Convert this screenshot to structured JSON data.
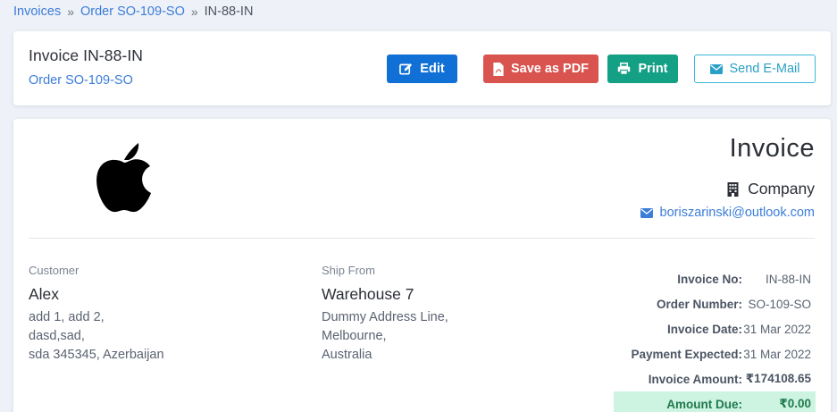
{
  "breadcrumb": {
    "items": [
      "Invoices",
      "Order SO-109-SO",
      "IN-88-IN"
    ],
    "separator": "»"
  },
  "header": {
    "title": "Invoice IN-88-IN",
    "order_link": "Order SO-109-SO",
    "buttons": {
      "edit": "Edit",
      "pdf": "Save as PDF",
      "print": "Print",
      "email": "Send E-Mail"
    }
  },
  "document": {
    "logo_icon": "apple-logo-icon",
    "title": "Invoice",
    "company": "Company",
    "email": "boriszarinski@outlook.com"
  },
  "customer": {
    "label": "Customer",
    "name": "Alex",
    "address": [
      "add 1, add 2,",
      "dasd,sad,",
      "sda 345345, Azerbaijan"
    ]
  },
  "ship_from": {
    "label": "Ship From",
    "name": "Warehouse 7",
    "address": [
      "Dummy Address Line,",
      "Melbourne,",
      "Australia"
    ]
  },
  "summary": {
    "invoice_no": {
      "label": "Invoice No:",
      "value": "IN-88-IN"
    },
    "order_number": {
      "label": "Order Number:",
      "value": "SO-109-SO"
    },
    "invoice_date": {
      "label": "Invoice Date:",
      "value": "31 Mar 2022"
    },
    "payment_expected": {
      "label": "Payment Expected:",
      "value": "31 Mar 2022"
    },
    "invoice_amount": {
      "label": "Invoice Amount:",
      "value": "₹174108.65"
    },
    "amount_due": {
      "label": "Amount Due:",
      "value": "₹0.00"
    }
  },
  "colors": {
    "edit": "#1170d6",
    "pdf": "#d9534f",
    "print": "#14a085",
    "email_border": "#38b6d8",
    "link": "#3b7dd8",
    "due_bg": "#cdf3e1"
  }
}
